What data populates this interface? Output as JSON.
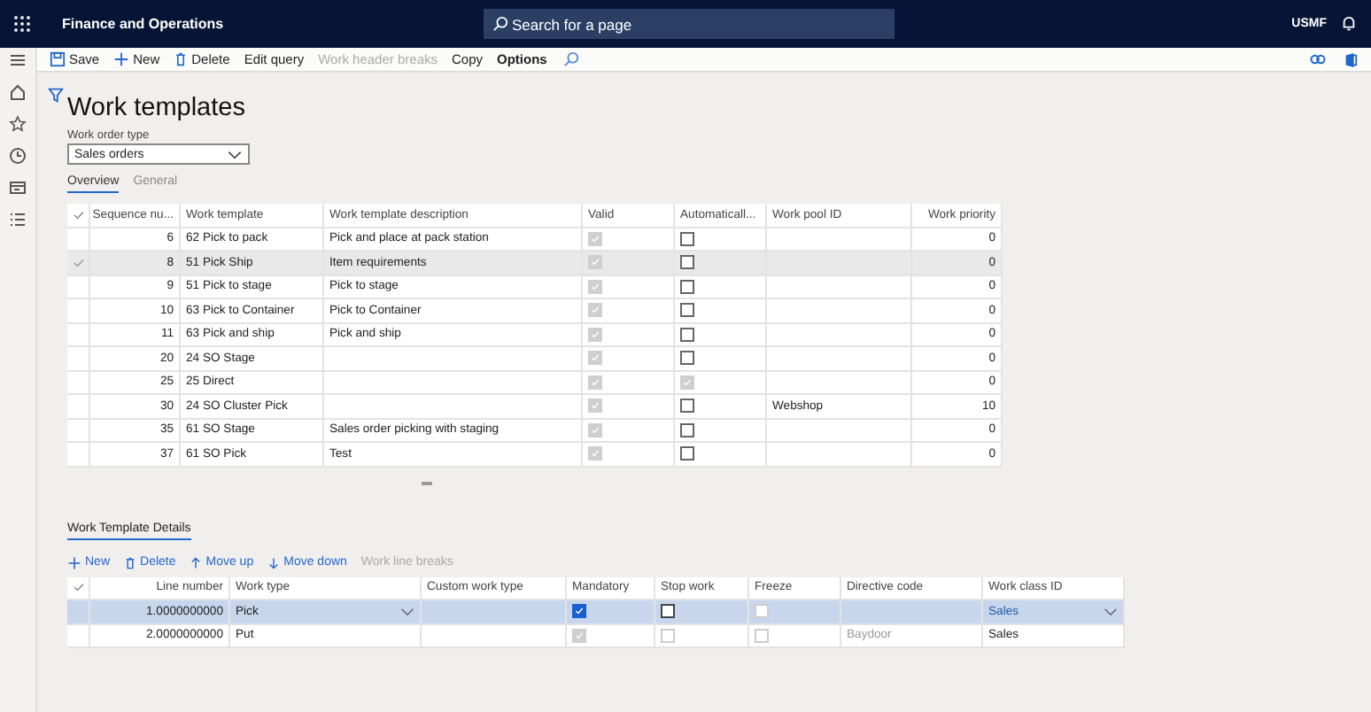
{
  "topbar": {
    "app_title": "Finance and Operations",
    "search": {
      "placeholder": "Search for a page"
    },
    "company": "USMF"
  },
  "action_bar": [
    {
      "label": "Save",
      "disabled": false,
      "bold": false
    },
    {
      "label": "New",
      "disabled": false,
      "bold": false
    },
    {
      "label": "Delete",
      "disabled": false,
      "bold": false
    },
    {
      "label": "Edit query",
      "disabled": false,
      "bold": false
    },
    {
      "label": "Work header breaks",
      "disabled": true,
      "bold": false
    },
    {
      "label": "Copy",
      "disabled": false,
      "bold": false
    },
    {
      "label": "Options",
      "disabled": false,
      "bold": true
    }
  ],
  "page_title": "Work templates",
  "work_order_type": {
    "label": "Work order type",
    "value": "Sales orders"
  },
  "tabs": [
    {
      "label": "Overview",
      "selected": true
    },
    {
      "label": "General",
      "selected": false
    }
  ],
  "templates": {
    "columns": [
      "Sequence nu...",
      "Work template",
      "Work template description",
      "Valid",
      "Automaticall...",
      "Work pool ID",
      "Work priority"
    ],
    "rows": [
      {
        "selected": false,
        "sequence": "6",
        "template": "62 Pick to pack",
        "description": "Pick and place at pack station",
        "valid": true,
        "auto": false,
        "priority": "0"
      },
      {
        "selected": true,
        "sequence": "8",
        "template": "51 Pick Ship",
        "description": "Item requirements",
        "valid": true,
        "auto": false,
        "priority": "0"
      },
      {
        "selected": false,
        "sequence": "9",
        "template": "51 Pick to stage",
        "description": "Pick to stage",
        "valid": true,
        "auto": false,
        "priority": "0"
      },
      {
        "selected": false,
        "sequence": "10",
        "template": "63 Pick to Container",
        "description": "Pick to Container",
        "valid": true,
        "auto": false,
        "priority": "0"
      },
      {
        "selected": false,
        "sequence": "11",
        "template": "63 Pick and ship",
        "description": "Pick and ship",
        "valid": true,
        "auto": false,
        "priority": "0"
      },
      {
        "selected": false,
        "sequence": "20",
        "template": "24 SO Stage",
        "valid": true,
        "auto": false,
        "priority": "0"
      },
      {
        "selected": false,
        "sequence": "25",
        "template": "25 Direct",
        "valid": true,
        "auto": true,
        "priority": "0"
      },
      {
        "selected": false,
        "sequence": "30",
        "template": "24 SO Cluster Pick",
        "valid": true,
        "auto": false,
        "pool": "Webshop",
        "priority": "10"
      },
      {
        "selected": false,
        "sequence": "35",
        "template": "61 SO Stage",
        "description": "Sales order picking with staging",
        "valid": true,
        "auto": false,
        "priority": "0"
      },
      {
        "selected": false,
        "sequence": "37",
        "template": "61 SO Pick",
        "description": "Test",
        "valid": true,
        "auto": false,
        "priority": "0"
      }
    ]
  },
  "details": {
    "title": "Work Template Details",
    "toolbar": [
      {
        "label": "New",
        "disabled": false
      },
      {
        "label": "Delete",
        "disabled": false
      },
      {
        "label": "Move up",
        "disabled": false
      },
      {
        "label": "Move down",
        "disabled": false
      },
      {
        "label": "Work line breaks",
        "disabled": true
      }
    ],
    "columns": [
      "Line number",
      "Work type",
      "Custom work type",
      "Mandatory",
      "Stop work",
      "Freeze",
      "Directive code",
      "Work class ID"
    ],
    "rows": [
      {
        "selected": true,
        "line": "1.0000000000",
        "work_type": "Pick",
        "mandatory": true,
        "mandatory_disabled": false,
        "stop": false,
        "stop_disabled": false,
        "freeze": false,
        "work_class": "Sales"
      },
      {
        "selected": false,
        "line": "2.0000000000",
        "work_type": "Put",
        "mandatory": true,
        "mandatory_disabled": true,
        "stop": false,
        "stop_disabled": true,
        "freeze": false,
        "directive": "Baydoor",
        "work_class": "Sales"
      }
    ]
  }
}
